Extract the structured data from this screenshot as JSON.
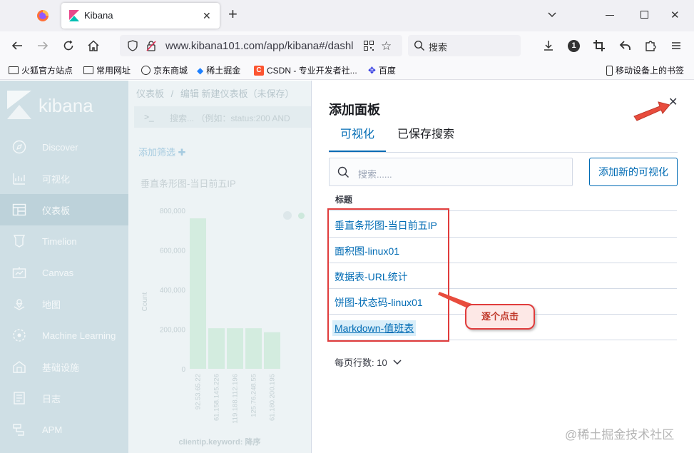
{
  "browser": {
    "tab_title": "Kibana",
    "url": "www.kibana101.com/app/kibana#/dashl",
    "search_placeholder": "搜索",
    "badge": "1",
    "bookmarks": [
      "火狐官方站点",
      "常用网址",
      "京东商城",
      "稀土掘金",
      "CSDN - 专业开发者社...",
      "百度"
    ],
    "mobile_bookmarks": "移动设备上的书签"
  },
  "sidebar": {
    "logo": "kibana",
    "items": [
      {
        "label": "Discover",
        "icon": "compass-icon"
      },
      {
        "label": "可视化",
        "icon": "visualize-icon"
      },
      {
        "label": "仪表板",
        "icon": "dashboard-icon"
      },
      {
        "label": "Timelion",
        "icon": "timelion-icon"
      },
      {
        "label": "Canvas",
        "icon": "canvas-icon"
      },
      {
        "label": "地图",
        "icon": "maps-icon"
      },
      {
        "label": "Machine Learning",
        "icon": "ml-icon"
      },
      {
        "label": "基础设施",
        "icon": "infra-icon"
      },
      {
        "label": "日志",
        "icon": "logs-icon"
      },
      {
        "label": "APM",
        "icon": "apm-icon"
      }
    ]
  },
  "dashboard": {
    "breadcrumb_root": "仪表板",
    "breadcrumb_sep": "/",
    "breadcrumb_current": "编辑 新建仪表板（未保存）",
    "query_prompt": ">_",
    "query_text": "搜索... （例如：status:200 AND",
    "add_filter": "添加筛选",
    "panel_title": "垂直条形图-当日前五IP",
    "y_axis_label": "Count",
    "x_axis_label": "clientip.keyword: 降序"
  },
  "chart_data": {
    "type": "bar",
    "title": "垂直条形图-当日前五IP",
    "xlabel": "clientip.keyword: 降序",
    "ylabel": "Count",
    "categories": [
      "92.53.65.22",
      "61.158.145.226",
      "119.188.112.196",
      "125.76.248.55",
      "61.180.200.195"
    ],
    "values": [
      760000,
      205000,
      205000,
      205000,
      185000
    ],
    "yticks": [
      "800,000",
      "600,000",
      "400,000",
      "200,000",
      "0"
    ],
    "ylim": [
      0,
      800000
    ]
  },
  "flyout": {
    "title": "添加面板",
    "tabs": [
      "可视化",
      "已保存搜索"
    ],
    "search_placeholder": "搜索......",
    "add_new_button": "添加新的可视化",
    "column_header": "标题",
    "items": [
      "垂直条形图-当日前五IP",
      "面积图-linux01",
      "数据表-URL统计",
      "饼图-状态码-linux01",
      "Markdown-值班表"
    ],
    "rows_per_page": "每页行数: 10"
  },
  "annotation": {
    "callout": "逐个点击",
    "highlight_color": "#e03c3c"
  },
  "watermark": "@稀土掘金技术社区"
}
